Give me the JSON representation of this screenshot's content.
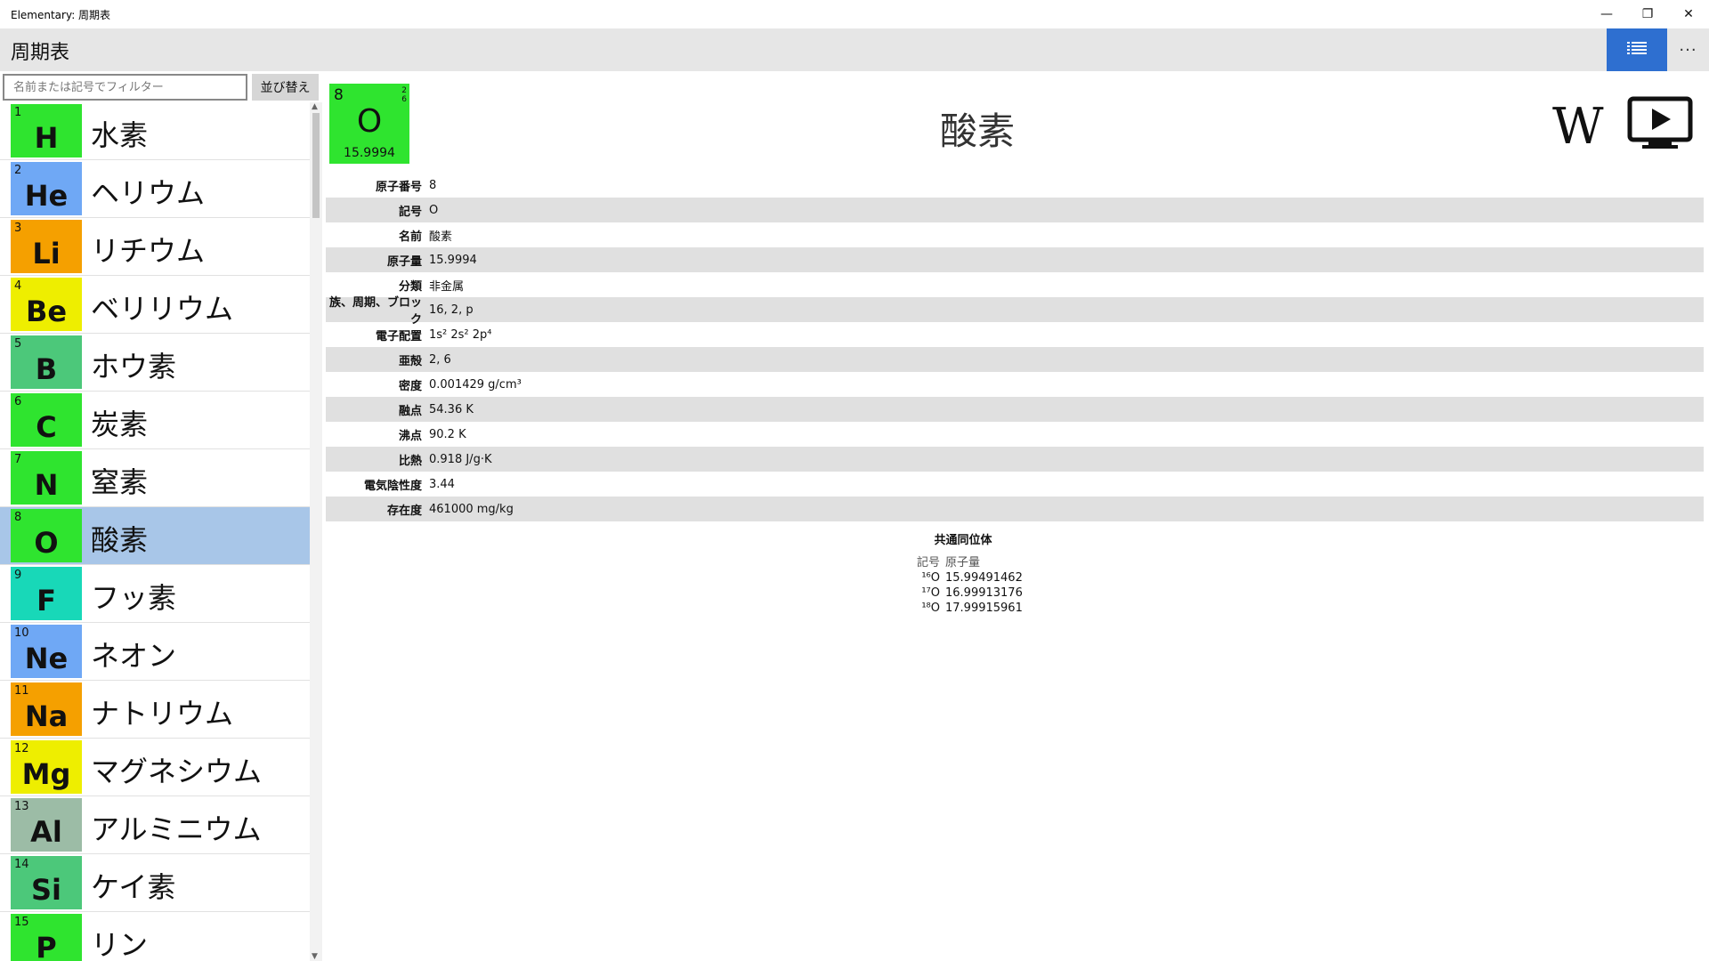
{
  "window": {
    "title": "Elementary: 周期表",
    "min_glyph": "—",
    "max_glyph": "❐",
    "close_glyph": "✕"
  },
  "header": {
    "title": "周期表",
    "more_glyph": "···",
    "accent": "#2e6fd0"
  },
  "sidebar": {
    "filter_placeholder": "名前または記号でフィルター",
    "sort_label": "並び替え",
    "elements": [
      {
        "num": "1",
        "sym": "H",
        "name": "水素",
        "color": "#2fe42f"
      },
      {
        "num": "2",
        "sym": "He",
        "name": "ヘリウム",
        "color": "#6fa8f5"
      },
      {
        "num": "3",
        "sym": "Li",
        "name": "リチウム",
        "color": "#f5a000"
      },
      {
        "num": "4",
        "sym": "Be",
        "name": "ベリリウム",
        "color": "#eeee00"
      },
      {
        "num": "5",
        "sym": "B",
        "name": "ホウ素",
        "color": "#4cc87a"
      },
      {
        "num": "6",
        "sym": "C",
        "name": "炭素",
        "color": "#2fe42f"
      },
      {
        "num": "7",
        "sym": "N",
        "name": "窒素",
        "color": "#2fe42f"
      },
      {
        "num": "8",
        "sym": "O",
        "name": "酸素",
        "color": "#2fe42f",
        "selected": true
      },
      {
        "num": "9",
        "sym": "F",
        "name": "フッ素",
        "color": "#18d8b8"
      },
      {
        "num": "10",
        "sym": "Ne",
        "name": "ネオン",
        "color": "#6fa8f5"
      },
      {
        "num": "11",
        "sym": "Na",
        "name": "ナトリウム",
        "color": "#f5a000"
      },
      {
        "num": "12",
        "sym": "Mg",
        "name": "マグネシウム",
        "color": "#eeee00"
      },
      {
        "num": "13",
        "sym": "Al",
        "name": "アルミニウム",
        "color": "#9cbca6"
      },
      {
        "num": "14",
        "sym": "Si",
        "name": "ケイ素",
        "color": "#4cc87a"
      },
      {
        "num": "15",
        "sym": "P",
        "name": "リン",
        "color": "#2fe42f"
      }
    ]
  },
  "detail": {
    "tile": {
      "num": "8",
      "sym": "O",
      "mass": "15.9994",
      "shells": [
        "2",
        "6"
      ],
      "color": "#2fe42f"
    },
    "title": "酸素",
    "wiki_glyph": "W",
    "properties": [
      {
        "label": "原子番号",
        "value": "8"
      },
      {
        "label": "記号",
        "value": "O"
      },
      {
        "label": "名前",
        "value": "酸素"
      },
      {
        "label": "原子量",
        "value": "15.9994"
      },
      {
        "label": "分類",
        "value": "非金属"
      },
      {
        "label": "族、周期、ブロック",
        "value": "16, 2, p"
      },
      {
        "label": "電子配置",
        "value": "1s² 2s² 2p⁴"
      },
      {
        "label": "亜殻",
        "value": "2, 6"
      },
      {
        "label": "密度",
        "value": "0.001429 g/cm³"
      },
      {
        "label": "融点",
        "value": "54.36 K"
      },
      {
        "label": "沸点",
        "value": "90.2 K"
      },
      {
        "label": "比熱",
        "value": "0.918 J/g·K"
      },
      {
        "label": "電気陰性度",
        "value": "3.44"
      },
      {
        "label": "存在度",
        "value": "461000 mg/kg"
      }
    ],
    "isotopes": {
      "title": "共通同位体",
      "header_symbol": "記号",
      "header_mass": "原子量",
      "rows": [
        {
          "symbol": "¹⁶O",
          "mass": "15.99491462"
        },
        {
          "symbol": "¹⁷O",
          "mass": "16.99913176"
        },
        {
          "symbol": "¹⁸O",
          "mass": "17.99915961"
        }
      ]
    }
  }
}
